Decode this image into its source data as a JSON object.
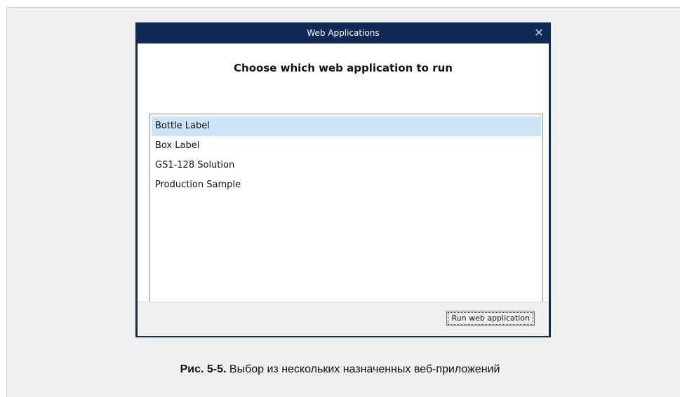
{
  "dialog": {
    "title": "Web Applications",
    "close_glyph": "✕",
    "heading": "Choose which web application to run",
    "items": [
      {
        "label": "Bottle Label",
        "selected": true
      },
      {
        "label": "Box Label",
        "selected": false
      },
      {
        "label": "GS1-128 Solution",
        "selected": false
      },
      {
        "label": "Production Sample",
        "selected": false
      }
    ],
    "run_button_label": "Run web application"
  },
  "caption": {
    "label": "Рис. 5-5.",
    "text": " Выбор из нескольких назначенных веб-приложений"
  },
  "colors": {
    "titlebar": "#0e2a55",
    "selection": "#cce4f7",
    "footer": "#f0f0f0",
    "frame": "#efefef"
  },
  "icons": {
    "close": "close-icon"
  }
}
